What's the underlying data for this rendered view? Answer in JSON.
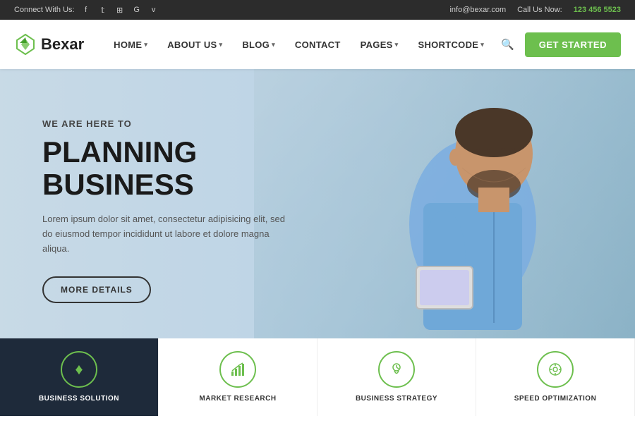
{
  "topbar": {
    "connect_label": "Connect With Us:",
    "email": "info@bexar.com",
    "call_label": "Call Us Now:",
    "phone": "123 456 5523",
    "socials": [
      "f",
      "t",
      "rss",
      "G",
      "v"
    ]
  },
  "header": {
    "logo_text": "Bexar",
    "nav_items": [
      {
        "label": "HOME",
        "has_arrow": true
      },
      {
        "label": "ABOUT US",
        "has_arrow": true
      },
      {
        "label": "BLOG",
        "has_arrow": true
      },
      {
        "label": "CONTACT",
        "has_arrow": false
      },
      {
        "label": "PAGES",
        "has_arrow": true
      },
      {
        "label": "SHORTCODE",
        "has_arrow": true
      }
    ],
    "cta_label": "GET STARTED"
  },
  "hero": {
    "subtitle": "WE ARE HERE TO",
    "title": "PLANNING BUSINESS",
    "description": "Lorem ipsum dolor sit amet, consectetur adipisicing elit, sed do eiusmod tempor incididunt ut labore et dolore magna aliqua.",
    "cta_label": "MORE DETAILS"
  },
  "services": [
    {
      "label": "BUSINESS SOLUTION",
      "icon": "♦"
    },
    {
      "label": "MARKET RESEARCH",
      "icon": "📊"
    },
    {
      "label": "BUSINESS STRATEGY",
      "icon": "💡"
    },
    {
      "label": "SPEED OPTIMIZATION",
      "icon": "🎯"
    }
  ],
  "colors": {
    "green": "#6dbf4e",
    "dark": "#1e2a3a",
    "topbar_bg": "#2c2c2c"
  }
}
